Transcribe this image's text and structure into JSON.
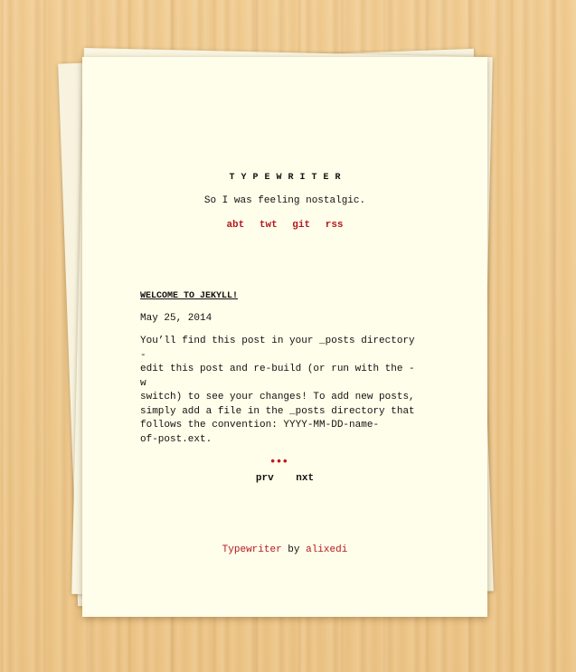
{
  "site": {
    "title": "TYPEWRITER",
    "tagline": "So I was feeling nostalgic.",
    "nav": [
      "abt",
      "twt",
      "git",
      "rss"
    ]
  },
  "post": {
    "title": "WELCOME TO JEKYLL!",
    "date": "May 25, 2014",
    "excerpt_lines": [
      "You’ll find this post in your _posts directory -",
      "edit this post and re-build (or run with the -w",
      "switch) to see your changes! To add new posts,",
      "simply add a file in the _posts directory that",
      "follows the convention: YYYY-MM-DD-name-",
      "of-post.ext."
    ],
    "read_more": "•••"
  },
  "pager": {
    "prev": "prv",
    "next": "nxt"
  },
  "footer": {
    "theme_link": "Typewriter",
    "by": "by",
    "author_link": "alixedi"
  },
  "colors": {
    "accent": "#b5171e",
    "paper": "#fffeea",
    "background": "#efc98c"
  }
}
